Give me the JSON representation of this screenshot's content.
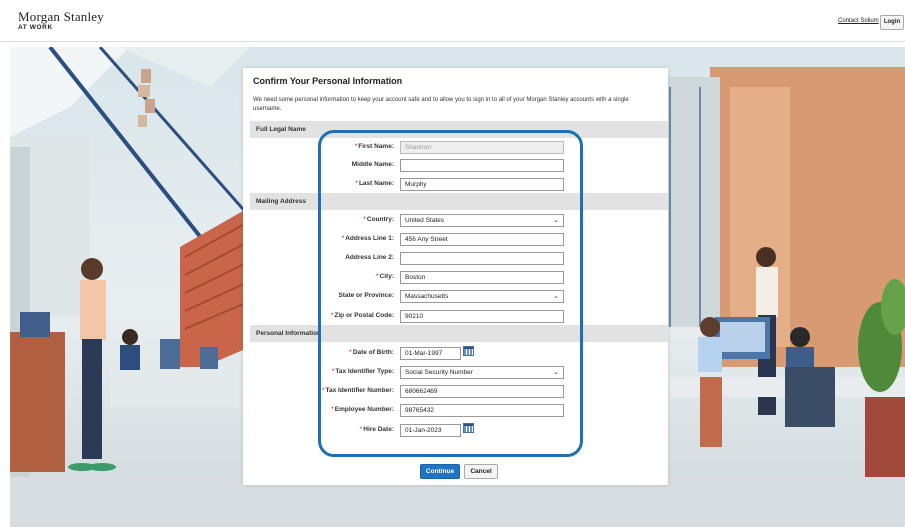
{
  "header": {
    "brand_name": "Morgan Stanley",
    "brand_sub": "AT WORK",
    "contact_link": "Contact Solium",
    "login_label": "Login"
  },
  "form": {
    "title": "Confirm Your Personal Information",
    "intro": "We need some personal information to keep your account safe and to allow you to sign in to all of your Morgan Stanley accounts with a single username.",
    "required_marker": "*",
    "sections": {
      "legal_name": "Full Legal Name",
      "mailing_address": "Mailing Address",
      "personal_info": "Personal Information"
    },
    "fields": {
      "first_name": {
        "label": "First Name:",
        "value": "Shannon",
        "required": true
      },
      "middle_name": {
        "label": "Middle Name:",
        "value": "",
        "required": false
      },
      "last_name": {
        "label": "Last Name:",
        "value": "Murphy",
        "required": true
      },
      "country": {
        "label": "Country:",
        "value": "United States",
        "required": true
      },
      "address1": {
        "label": "Address Line 1:",
        "value": "456 Any Street",
        "required": true
      },
      "address2": {
        "label": "Address Line 2:",
        "value": "",
        "required": false
      },
      "city": {
        "label": "City:",
        "value": "Boston",
        "required": true
      },
      "state": {
        "label": "State or Province:",
        "value": "Massachusetts",
        "required": false
      },
      "zip": {
        "label": "Zip or Postal Code:",
        "value": "90210",
        "required": true
      },
      "dob": {
        "label": "Date of Birth:",
        "value": "01-Mar-1997",
        "required": true
      },
      "tax_type": {
        "label": "Tax Identifier Type:",
        "value": "Social Security Number",
        "required": true
      },
      "tax_number": {
        "label": "Tax Identifier Number:",
        "value": "680662469",
        "required": true
      },
      "employee_number": {
        "label": "Employee Number:",
        "value": "98765432",
        "required": true
      },
      "hire_date": {
        "label": "Hire Date:",
        "value": "01-Jan-2023",
        "required": true
      }
    },
    "buttons": {
      "continue": "Continue",
      "cancel": "Cancel"
    }
  },
  "colors": {
    "accent": "#1f74c4",
    "highlight": "#1e6fb5",
    "section_bg": "#e2e2e2"
  }
}
